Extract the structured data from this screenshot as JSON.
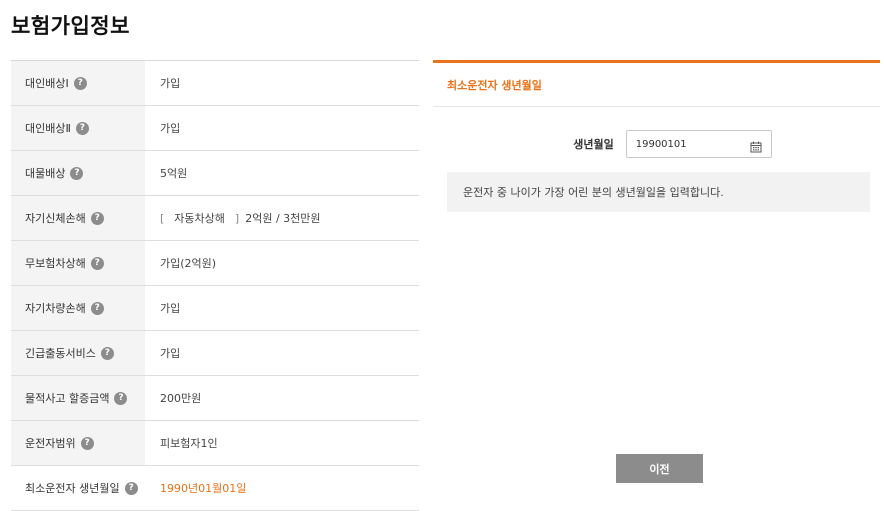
{
  "page_title": "보험가입정보",
  "rows": [
    {
      "label": "대인배상Ⅰ",
      "value": "가입"
    },
    {
      "label": "대인배상Ⅱ",
      "value": "가입"
    },
    {
      "label": "대물배상",
      "value": "5억원"
    },
    {
      "label": "자기신체손해",
      "value_open": "[",
      "value_main": "자동차상해",
      "value_close": "]",
      "value_rest": "2억원 / 3천만원"
    },
    {
      "label": "무보험차상해",
      "value": "가입(2억원)"
    },
    {
      "label": "자기차량손해",
      "value": "가입"
    },
    {
      "label": "긴급출동서비스",
      "value": "가입"
    },
    {
      "label": "물적사고 할증금액",
      "value": "200만원"
    },
    {
      "label": "운전자범위",
      "value": "피보험자1인"
    },
    {
      "label": "최소운전자 생년월일",
      "value": "1990년01월01일"
    }
  ],
  "help_glyph": "?",
  "panel": {
    "title": "최소운전자 생년월일",
    "birth_label": "생년월일",
    "birth_value": "19900101",
    "notice": "운전자 중 나이가 가장 어린 분의 생년월일을 입력합니다.",
    "prev_button": "이전"
  },
  "colors": {
    "accent": "#e8731a",
    "label_bg": "#f4f4f4",
    "button_gray": "#8c8c8c",
    "notice_bg": "#f2f2f2"
  },
  "icons": {
    "help": "help-icon",
    "calendar": "calendar-icon"
  }
}
